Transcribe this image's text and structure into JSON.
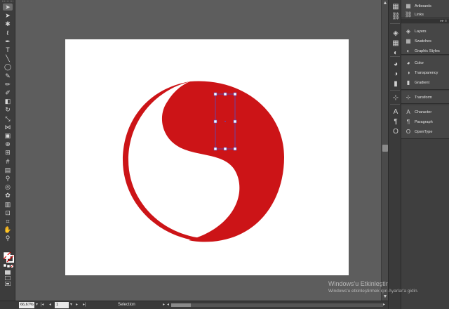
{
  "toolbox": {
    "tools": [
      {
        "name": "selection-tool-icon",
        "glyph": "➤",
        "active": true
      },
      {
        "name": "direct-selection-tool-icon",
        "glyph": "➤"
      },
      {
        "name": "magic-wand-tool-icon",
        "glyph": "✱"
      },
      {
        "name": "lasso-tool-icon",
        "glyph": "ℓ"
      },
      {
        "name": "pen-tool-icon",
        "glyph": "✒"
      },
      {
        "name": "type-tool-icon",
        "glyph": "T"
      },
      {
        "name": "line-segment-tool-icon",
        "glyph": "╲"
      },
      {
        "name": "ellipse-tool-icon",
        "glyph": "◯"
      },
      {
        "name": "paintbrush-tool-icon",
        "glyph": "✎"
      },
      {
        "name": "pencil-tool-icon",
        "glyph": "✏"
      },
      {
        "name": "blob-brush-tool-icon",
        "glyph": "✐"
      },
      {
        "name": "eraser-tool-icon",
        "glyph": "◧"
      },
      {
        "name": "rotate-tool-icon",
        "glyph": "↻"
      },
      {
        "name": "scale-tool-icon",
        "glyph": "⤡"
      },
      {
        "name": "width-tool-icon",
        "glyph": "⋈"
      },
      {
        "name": "free-transform-tool-icon",
        "glyph": "▣"
      },
      {
        "name": "shape-builder-tool-icon",
        "glyph": "⊕"
      },
      {
        "name": "perspective-grid-tool-icon",
        "glyph": "⊞"
      },
      {
        "name": "mesh-tool-icon",
        "glyph": "#"
      },
      {
        "name": "gradient-tool-icon",
        "glyph": "▤"
      },
      {
        "name": "eyedropper-tool-icon",
        "glyph": "⚲"
      },
      {
        "name": "blend-tool-icon",
        "glyph": "◎"
      },
      {
        "name": "symbol-sprayer-tool-icon",
        "glyph": "✿"
      },
      {
        "name": "column-graph-tool-icon",
        "glyph": "▥"
      },
      {
        "name": "artboard-tool-icon",
        "glyph": "⊡"
      },
      {
        "name": "slice-tool-icon",
        "glyph": "⌗"
      },
      {
        "name": "hand-tool-icon",
        "glyph": "✋"
      },
      {
        "name": "zoom-tool-icon",
        "glyph": "⚲"
      }
    ],
    "swatch_icons": [
      "fill-stroke-swatch-icon",
      "default-colors-icon",
      "color-mode-icon",
      "drawing-mode-icon",
      "screen-mode-icon"
    ]
  },
  "canvas": {
    "artboard_color": "#ffffff",
    "artwork_color": "#cc1417",
    "selection_color": "#5050c8",
    "background_color": "#5d5d5d"
  },
  "icon_strip": {
    "icons": [
      "artboards-icon",
      "links-icon",
      "layers-icon",
      "swatches-icon",
      "graphic-styles-icon",
      "color-icon",
      "transparency-icon",
      "gradient-icon",
      "transform-icon",
      "character-icon",
      "paragraph-icon",
      "opentype-icon"
    ]
  },
  "panels": {
    "group1": [
      {
        "label": "Artboards",
        "icon": "artboards-icon",
        "glyph": "▦"
      },
      {
        "label": "Links",
        "icon": "links-icon",
        "glyph": "⛓"
      }
    ],
    "group2": [
      {
        "label": "Layers",
        "icon": "layers-icon",
        "glyph": "◈"
      },
      {
        "label": "Swatches",
        "icon": "swatches-icon",
        "glyph": "▦"
      },
      {
        "label": "Graphic Styles",
        "icon": "graphic-styles-icon",
        "glyph": "◐"
      }
    ],
    "group3": [
      {
        "label": "Color",
        "icon": "color-icon",
        "glyph": "◕"
      },
      {
        "label": "Transparency",
        "icon": "transparency-icon",
        "glyph": "◑"
      },
      {
        "label": "Gradient",
        "icon": "gradient-icon",
        "glyph": "▮"
      }
    ],
    "group4": [
      {
        "label": "Transform",
        "icon": "transform-icon",
        "glyph": "⊹"
      }
    ],
    "group5": [
      {
        "label": "Character",
        "icon": "character-icon",
        "glyph": "A"
      },
      {
        "label": "Paragraph",
        "icon": "paragraph-icon",
        "glyph": "¶"
      },
      {
        "label": "OpenType",
        "icon": "opentype-icon",
        "glyph": "O"
      }
    ],
    "collapse_glyph": "▸▸ ≡"
  },
  "statusbar": {
    "zoom": "66,67%",
    "page": "1",
    "first_glyph": "|◂",
    "prev_glyph": "◂",
    "next_glyph": "▸",
    "last_glyph": "▸|",
    "mode": "Selection",
    "mode_arrow": "▸",
    "scroll_left_glyph": "◂",
    "scroll_right_glyph": "▸"
  },
  "watermark": {
    "title": "Windows'u Etkinleştir",
    "subtitle": "Windows'u etkinleştirmek için Ayarlar'a gidin."
  }
}
